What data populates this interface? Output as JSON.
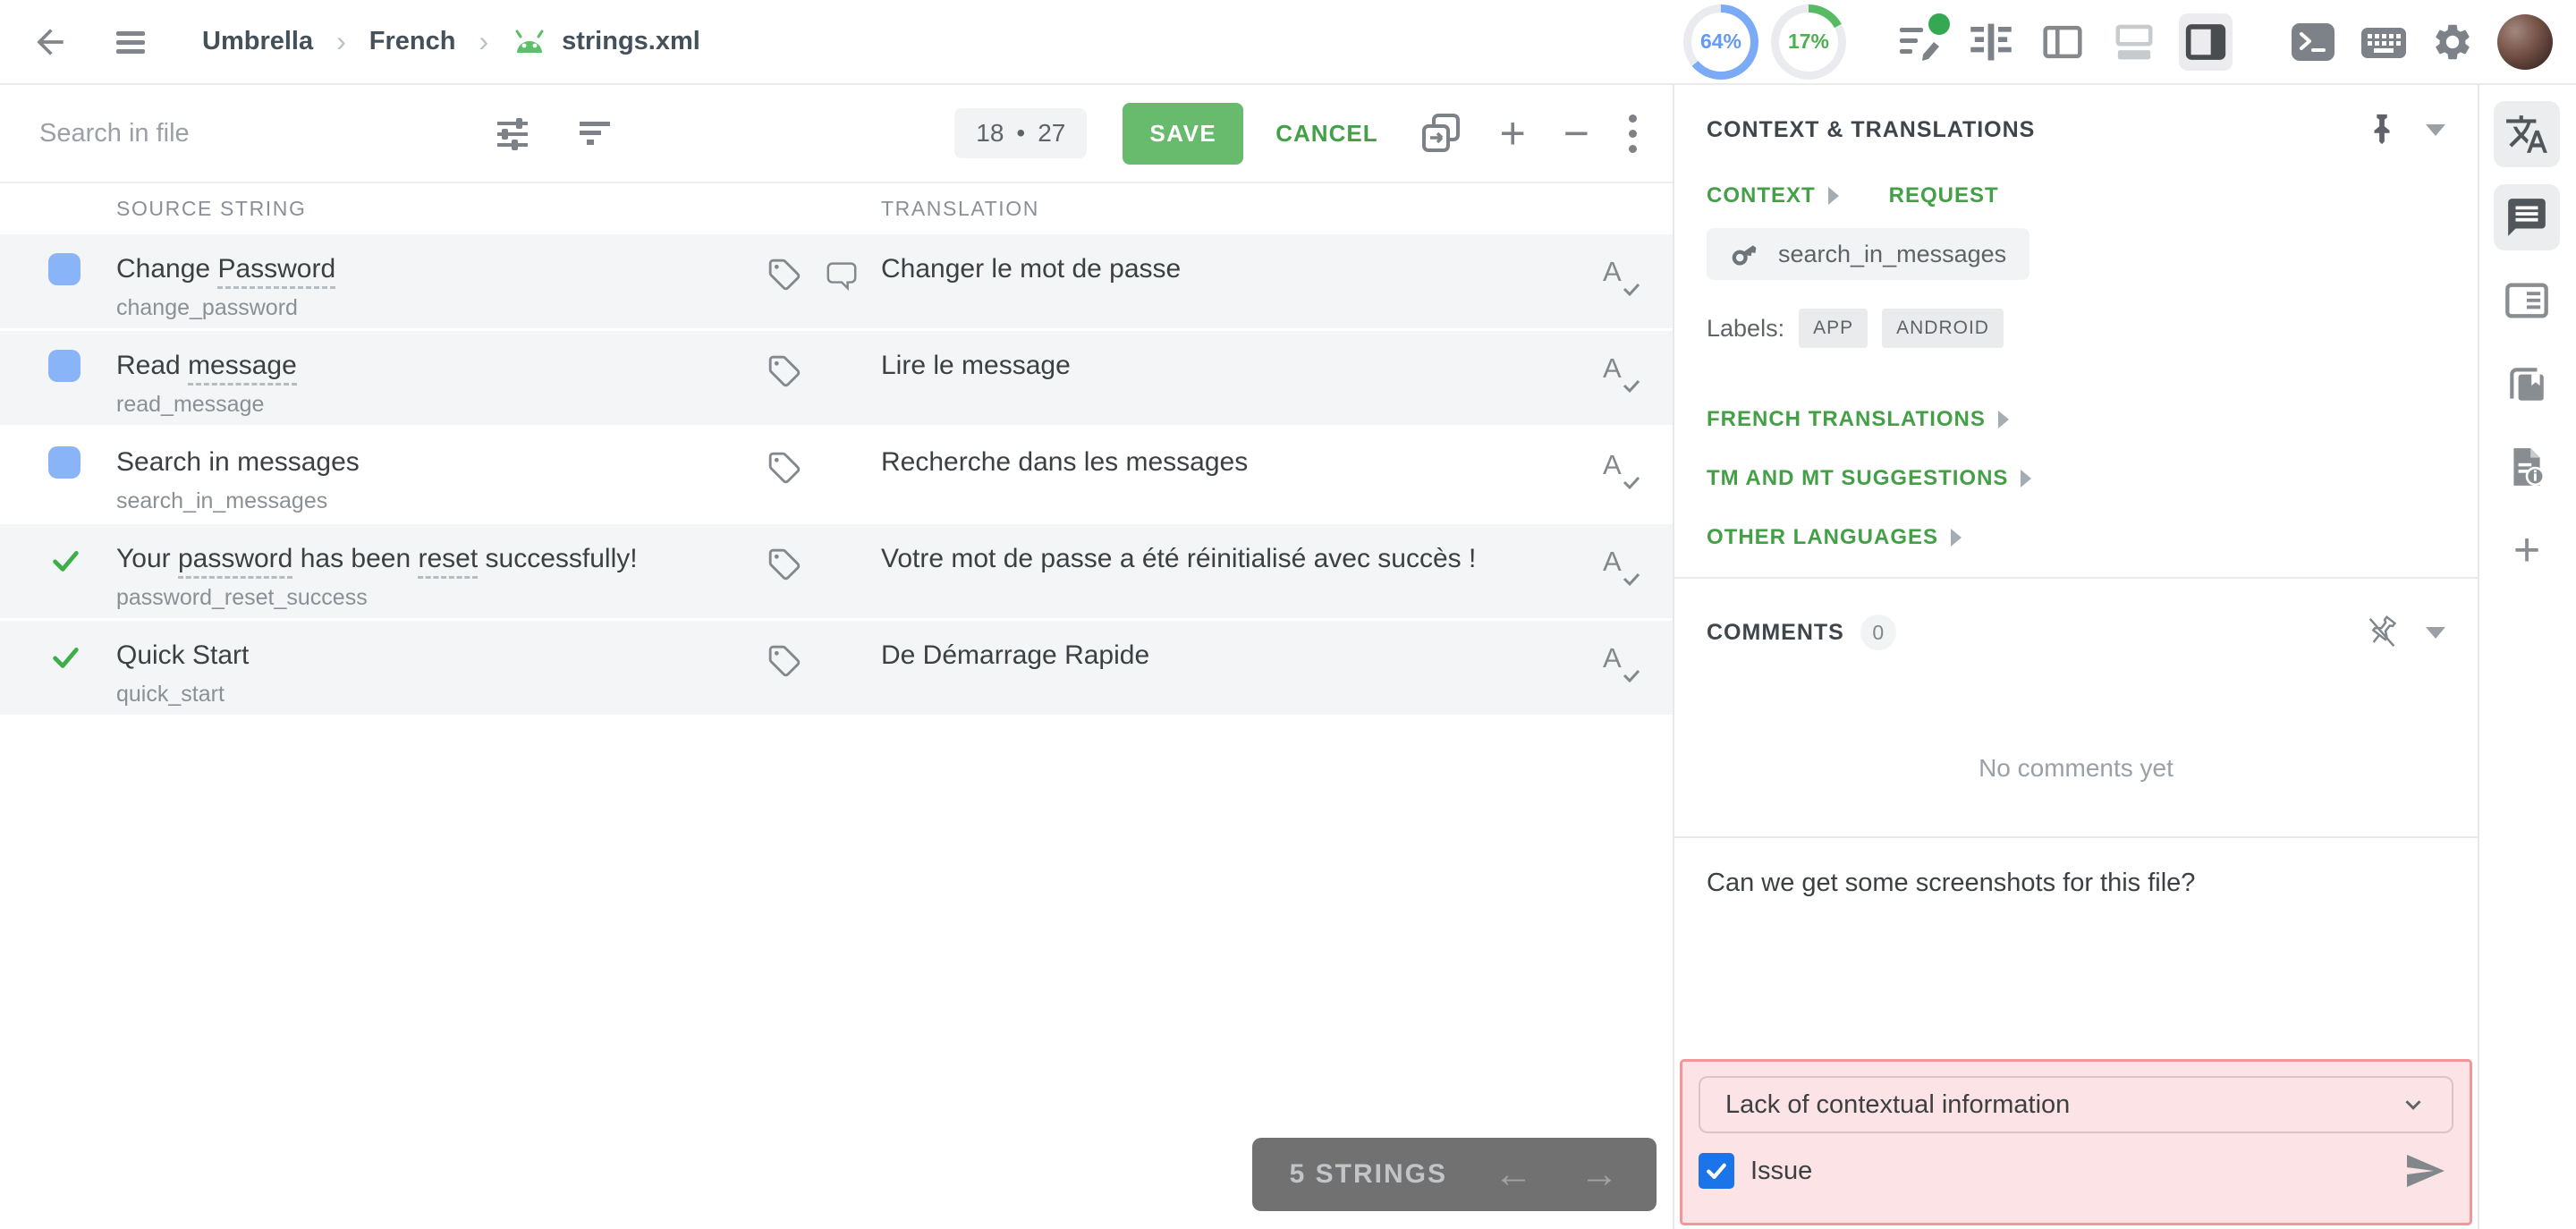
{
  "topbar": {
    "breadcrumb": {
      "project": "Umbrella",
      "language": "French",
      "file": "strings.xml"
    },
    "progress": [
      {
        "value": "64%",
        "pct": 64,
        "color": "#7baaf7",
        "text_color": "#639af5"
      },
      {
        "value": "17%",
        "pct": 17,
        "color": "#57bb63",
        "text_color": "#4caf50"
      }
    ]
  },
  "toolbar": {
    "search_placeholder": "Search in file",
    "counter": {
      "current": "18",
      "separator": "•",
      "total": "27"
    },
    "save_label": "SAVE",
    "cancel_label": "CANCEL"
  },
  "table": {
    "headers": {
      "source": "SOURCE STRING",
      "translation": "TRANSLATION"
    },
    "rows": [
      {
        "status": "translated",
        "selected": false,
        "source": [
          {
            "t": "Change "
          },
          {
            "t": "Password",
            "term": true
          }
        ],
        "key": "change_password",
        "icons": [
          "tag",
          "comment"
        ],
        "translation": "Changer le mot de passe"
      },
      {
        "status": "translated",
        "selected": false,
        "source": [
          {
            "t": "Read "
          },
          {
            "t": "message",
            "term": true
          }
        ],
        "key": "read_message",
        "icons": [
          "tag"
        ],
        "translation": "Lire le message"
      },
      {
        "status": "translated",
        "selected": true,
        "source": [
          {
            "t": "Search in messages"
          }
        ],
        "key": "search_in_messages",
        "icons": [
          "tag"
        ],
        "translation": "Recherche dans les messages"
      },
      {
        "status": "approved",
        "selected": false,
        "source": [
          {
            "t": "Your "
          },
          {
            "t": "password",
            "term": true
          },
          {
            "t": " has been "
          },
          {
            "t": "reset",
            "term": true
          },
          {
            "t": " successfully!"
          }
        ],
        "key": "password_reset_success",
        "icons": [
          "tag"
        ],
        "translation": "Votre mot de passe a été réinitialisé avec succès !"
      },
      {
        "status": "approved",
        "selected": false,
        "source": [
          {
            "t": "Quick Start"
          }
        ],
        "key": "quick_start",
        "icons": [
          "tag"
        ],
        "translation": "De Démarrage Rapide"
      }
    ]
  },
  "pager": {
    "label": "5 STRINGS"
  },
  "context_panel": {
    "title": "CONTEXT & TRANSLATIONS",
    "tabs": {
      "context": "CONTEXT",
      "request": "REQUEST"
    },
    "string_key": "search_in_messages",
    "labels_title": "Labels:",
    "labels": [
      "APP",
      "ANDROID"
    ],
    "sections": [
      "FRENCH TRANSLATIONS",
      "TM AND MT SUGGESTIONS",
      "OTHER LANGUAGES"
    ]
  },
  "comments_panel": {
    "title": "COMMENTS",
    "count": "0",
    "empty_message": "No comments yet",
    "draft_text": "Can we get some screenshots for this file?",
    "issue_type_selected": "Lack of contextual information",
    "issue_checkbox_label": "Issue",
    "issue_checked": true
  },
  "icons": {
    "topbar": [
      "back-arrow",
      "hamburger",
      "android",
      "proofread-edit",
      "grid-view",
      "left-panel-view",
      "bottom-panel-view",
      "right-panel-view",
      "terminal",
      "keyboard",
      "gear"
    ],
    "toolbar": [
      "tune",
      "filter",
      "copy-source",
      "plus",
      "minus",
      "kebab"
    ],
    "row": [
      "tag",
      "comment-bubble",
      "spellcheck",
      "approved-check"
    ],
    "context": [
      "key",
      "pin",
      "pin-off",
      "caret-down",
      "triangle-right"
    ],
    "comments": [
      "send",
      "checkbox-check",
      "chevron-down"
    ],
    "sidebar": [
      "translate",
      "comments-chat",
      "terms-card",
      "screenshots-pages",
      "file-info",
      "plus"
    ]
  },
  "colors": {
    "accent_green": "#43a047",
    "save_green": "#68ba6c",
    "progress_blue": "#7baaf7",
    "progress_green": "#57bb63",
    "status_translated_blue": "#8ab4f8",
    "status_approved_green": "#3fae4a",
    "issue_border": "#f2969a",
    "issue_bg": "#fce3e5",
    "checkbox_blue": "#1b74e8",
    "row_bg": "#f3f5f6",
    "pager_bg": "#717171"
  }
}
